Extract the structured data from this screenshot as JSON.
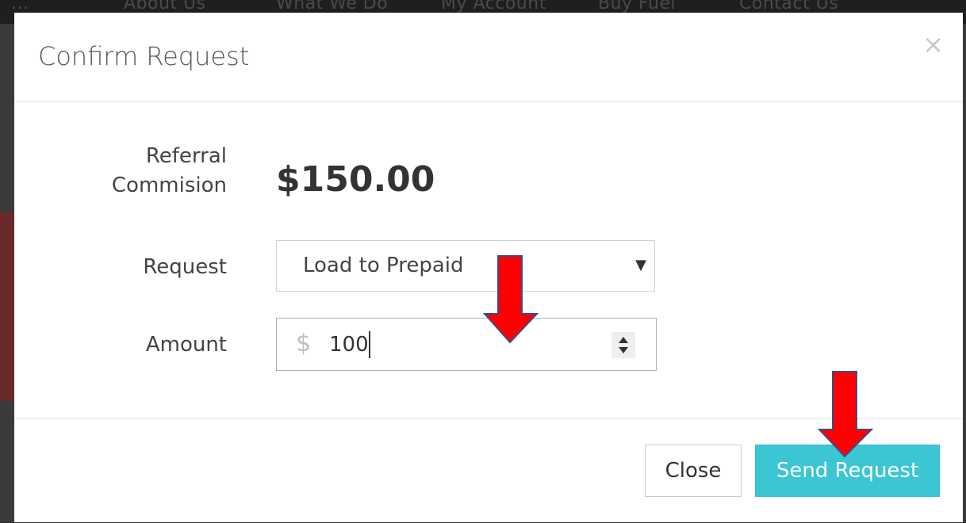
{
  "background_nav": {
    "items": [
      "...",
      "About Us",
      "What We Do",
      "My Account",
      "Buy Fuel",
      "Contact Us"
    ]
  },
  "modal": {
    "title": "Confirm Request",
    "close_glyph": "×",
    "referral_label_line1": "Referral",
    "referral_label_line2": "Commision",
    "referral_amount": "$150.00",
    "request_label": "Request",
    "request_selected": "Load to Prepaid",
    "amount_label": "Amount",
    "amount_prefix": "$",
    "amount_value": "100",
    "close_button": "Close",
    "send_button": "Send Request"
  },
  "colors": {
    "accent": "#3cc5d3",
    "arrow_red": "#ff0000",
    "arrow_outline": "#3a4f8a"
  },
  "icons": {
    "select_caret": "chevron-down-icon",
    "spinner": "number-spinner-icon",
    "close": "close-icon"
  }
}
